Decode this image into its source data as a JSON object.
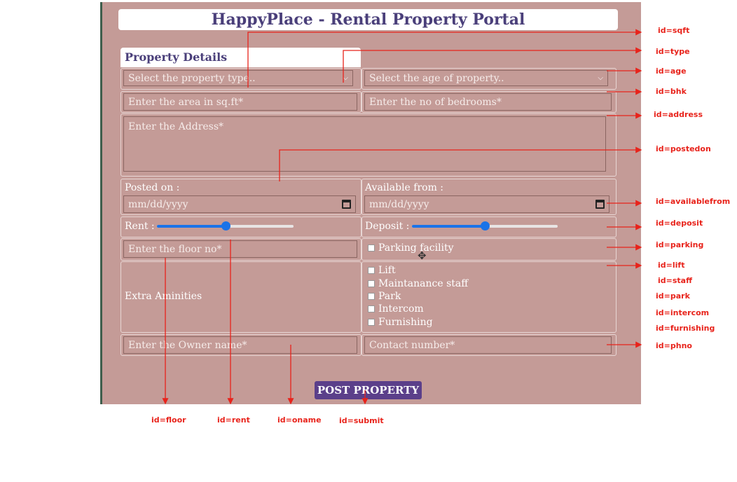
{
  "header": {
    "title": "HappyPlace - Rental Property Portal",
    "section": "Property Details"
  },
  "form": {
    "type_placeholder": "Select the property type..",
    "age_placeholder": "Select the age of property..",
    "sqft_placeholder": "Enter the area in sq.ft*",
    "bhk_placeholder": "Enter the no of bedrooms*",
    "address_placeholder": "Enter the Address*",
    "posted_label": "Posted on :",
    "available_label": "Available from :",
    "date_placeholder": "mm/dd/yyyy",
    "rent_label": "Rent :",
    "deposit_label": "Deposit :",
    "rent_level": 0.5,
    "deposit_level": 0.5,
    "floor_placeholder": "Enter the floor no*",
    "parking_label": "Parking facility",
    "extra_label": "Extra Aminities",
    "amenities": [
      "Lift",
      "Maintanance staff",
      "Park",
      "Intercom",
      "Furnishing"
    ],
    "owner_placeholder": "Enter the Owner name*",
    "phone_placeholder": "Contact number*",
    "submit_label": "POST PROPERTY"
  },
  "annotations": {
    "sqft": "id=sqft",
    "type": "id=type",
    "age": "id=age",
    "bhk": "id=bhk",
    "address": "id=address",
    "postedon": "id=postedon",
    "availablefrom": "id=availablefrom",
    "deposit": "id=deposit",
    "parking": "id=parking",
    "lift": "id=lift",
    "staff": "id=staff",
    "park": "id=park",
    "intercom": "id=intercom",
    "furnishing": "id=furnishing",
    "phno": "id=phno",
    "floor": "id=floor",
    "rent": "id=rent",
    "oname": "id=oname",
    "submit": "id=submit"
  },
  "colors": {
    "panel": "#c49b97",
    "title_text": "#4a3f7a",
    "annotation": "#e8231b",
    "slider": "#1a73e8",
    "button": "#5b3f8a"
  }
}
